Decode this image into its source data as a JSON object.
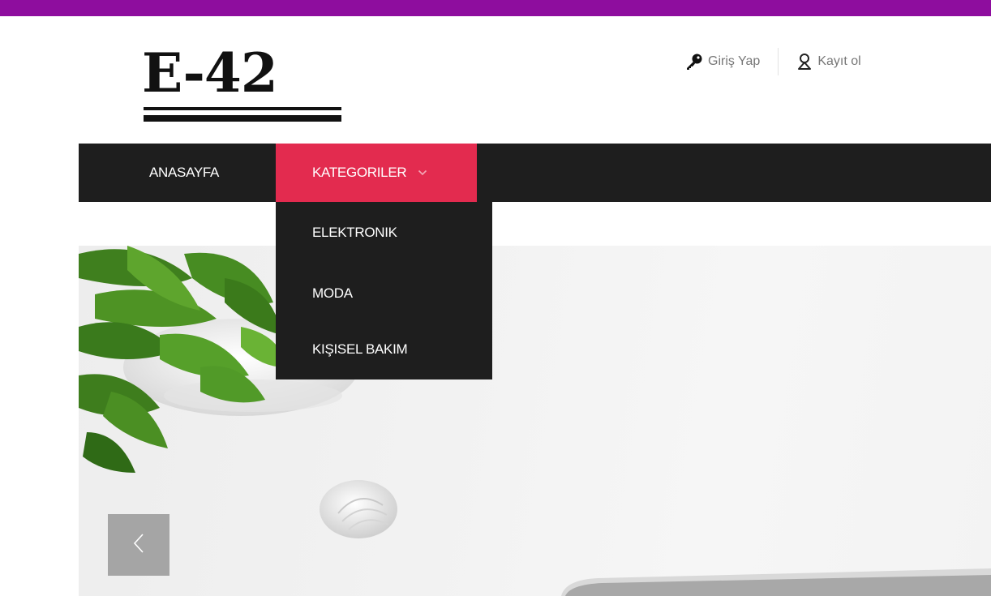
{
  "brand": {
    "logo_text": "E-42"
  },
  "account": {
    "login_label": "Giriş Yap",
    "login_icon": "key-icon",
    "register_label": "Kayıt ol",
    "register_icon": "user-icon"
  },
  "nav": {
    "home_label": "ANASAYFA",
    "categories_label": "KATEGORILER",
    "categories_icon": "chevron-down-icon",
    "dropdown": [
      {
        "label": "ELEKTRONIK"
      },
      {
        "label": "MODA"
      },
      {
        "label": "KIŞISEL BAKIM"
      }
    ]
  },
  "slider": {
    "prev_icon": "chevron-left-icon"
  },
  "colors": {
    "top_bar": "#8e0d9e",
    "nav_background": "#1e1e1e",
    "active_nav": "#e32b4f",
    "link_text": "#777777"
  }
}
